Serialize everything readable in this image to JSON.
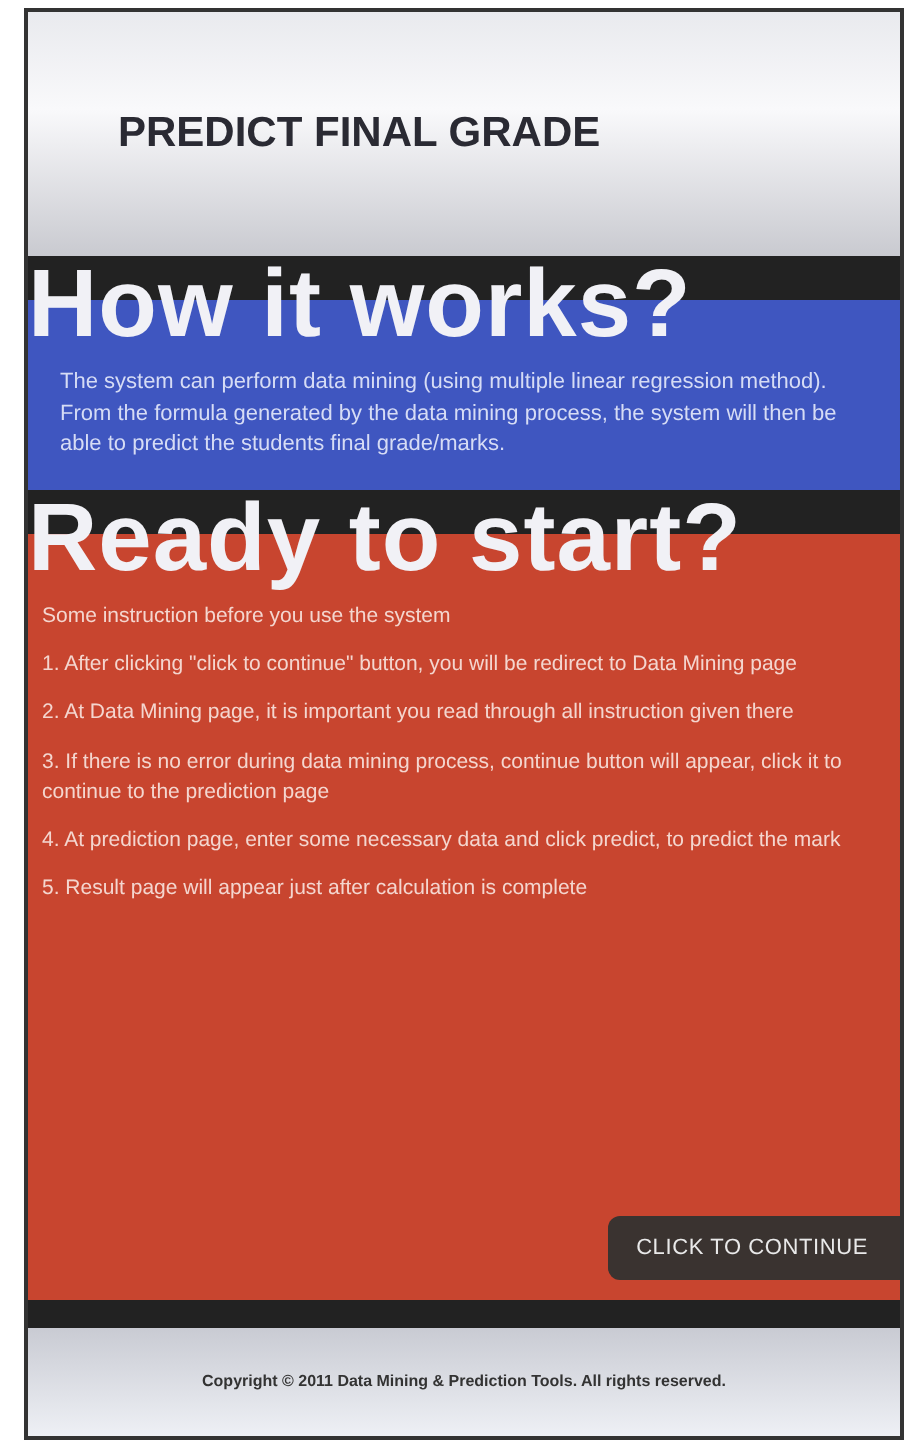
{
  "header": {
    "title": "PREDICT FINAL GRADE"
  },
  "how_it_works": {
    "heading": "How it works?",
    "text": "The system can perform data mining (using multiple linear regression method). From the formula generated by the data mining process, the system will then be able to predict the students final grade/marks."
  },
  "ready_to_start": {
    "heading": "Ready to start?",
    "intro": "Some instruction before you use the system",
    "steps": [
      "1. After clicking \"click to continue\" button, you will be redirect to Data Mining page",
      "2. At Data Mining page, it is important you read through all instruction given there",
      "3. If there is no error during data mining process, continue button will appear, click it to continue to the prediction page",
      "4. At prediction page, enter some necessary data and click predict, to predict the mark",
      "5. Result page will appear just after calculation is complete"
    ],
    "button": "CLICK TO CONTINUE"
  },
  "footer": {
    "text": "Copyright © 2011 Data Mining & Prediction Tools. All rights reserved."
  }
}
